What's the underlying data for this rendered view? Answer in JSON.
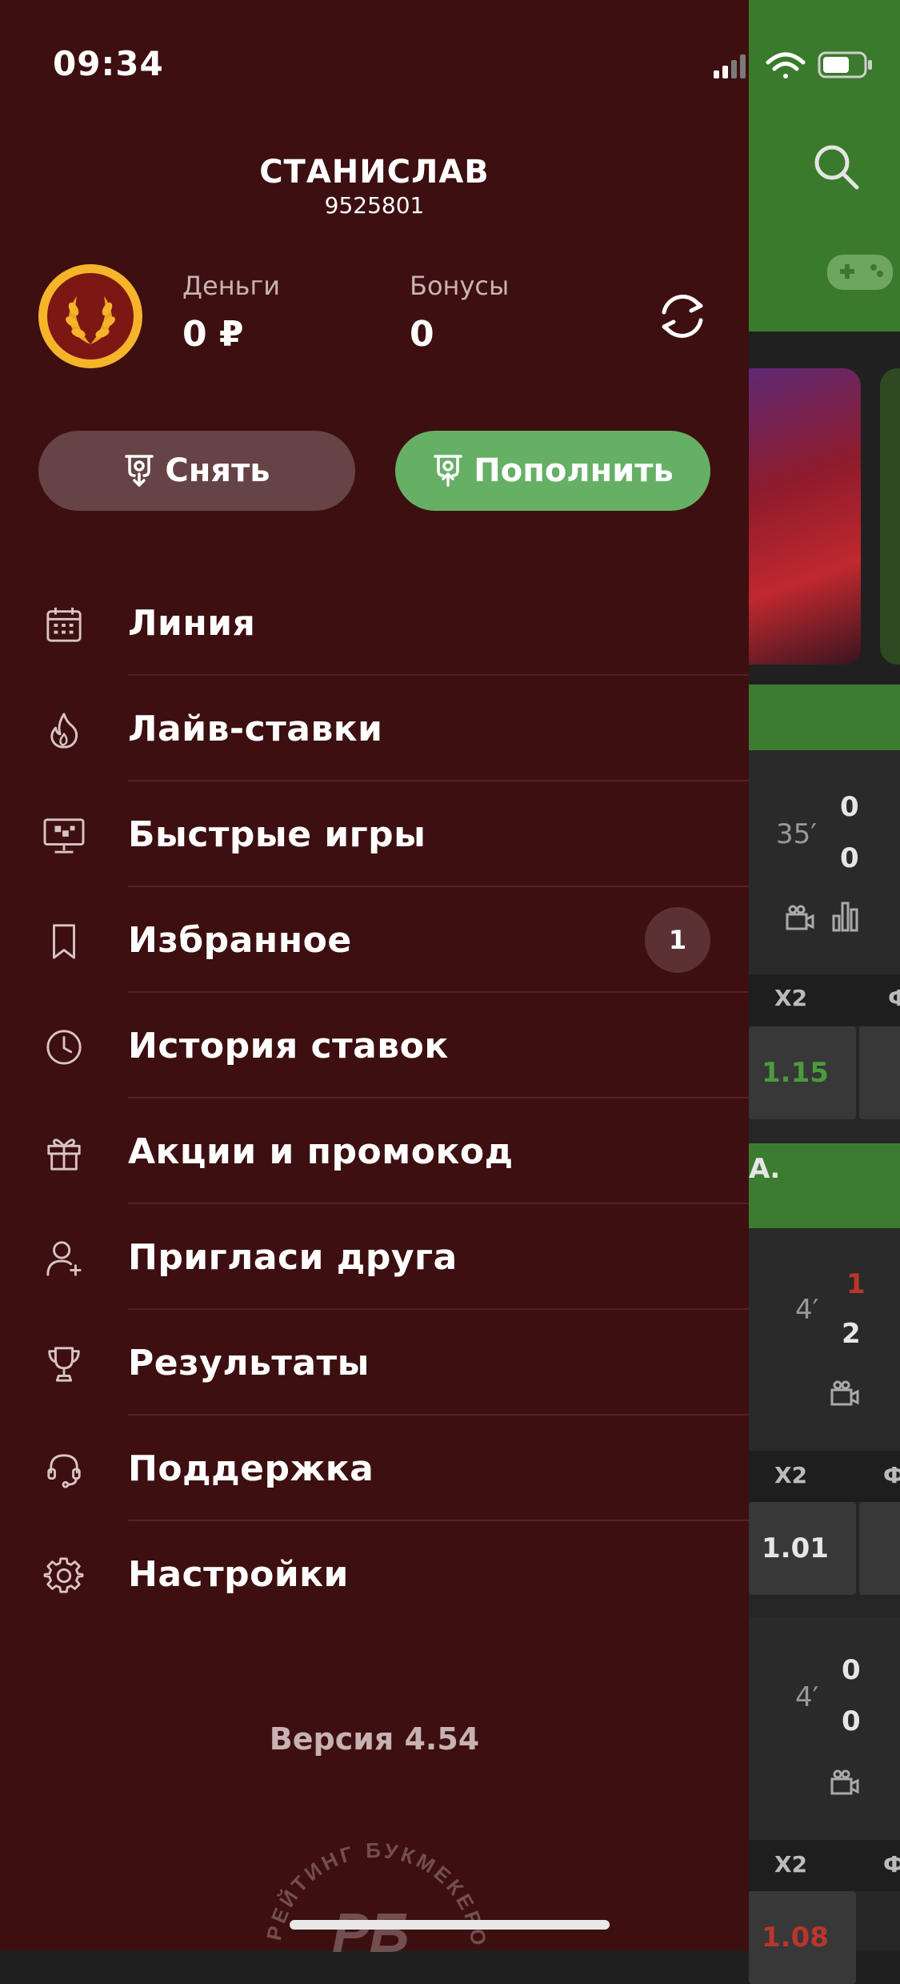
{
  "status_bar": {
    "time": "09:34"
  },
  "user": {
    "name": "СТАНИСЛАВ",
    "id": "9525801"
  },
  "balance": {
    "money_label": "Деньги",
    "money_value": "0 ₽",
    "bonus_label": "Бонусы",
    "bonus_value": "0"
  },
  "actions": {
    "withdraw_label": "Снять",
    "deposit_label": "Пополнить"
  },
  "menu": {
    "items": [
      {
        "label": "Линия",
        "icon": "calendar-icon"
      },
      {
        "label": "Лайв-ставки",
        "icon": "flame-icon"
      },
      {
        "label": "Быстрые игры",
        "icon": "monitor-icon"
      },
      {
        "label": "Избранное",
        "icon": "bookmark-icon",
        "badge": "1"
      },
      {
        "label": "История ставок",
        "icon": "clock-icon"
      },
      {
        "label": "Акции и промокод",
        "icon": "gift-icon"
      },
      {
        "label": "Пригласи друга",
        "icon": "add-user-icon"
      },
      {
        "label": "Результаты",
        "icon": "trophy-icon"
      },
      {
        "label": "Поддержка",
        "icon": "headset-icon"
      },
      {
        "label": "Настройки",
        "icon": "gear-icon"
      }
    ]
  },
  "version": "Версия 4.54",
  "watermark_text": "РЕЙТИНГ БУКМЕКЕРОВ",
  "background": {
    "matches": [
      {
        "minute": "35′",
        "score_top": "0",
        "score_bottom": "0",
        "market": "Х2",
        "odd": "1.15"
      },
      {
        "minute": "4′",
        "score_top": "1",
        "score_bottom": "2",
        "market": "Х2",
        "odd": "1.01"
      },
      {
        "minute": "4′",
        "score_top": "0",
        "score_bottom": "0",
        "market": "Х2",
        "odd": "1.08"
      }
    ],
    "league_fragment": "А.",
    "market_fragment": "Ф"
  },
  "colors": {
    "drawer_bg": "#3d0f11",
    "deposit_green": "#66b065",
    "withdraw_brown": "#664345",
    "header_green": "#3a7a2c"
  }
}
